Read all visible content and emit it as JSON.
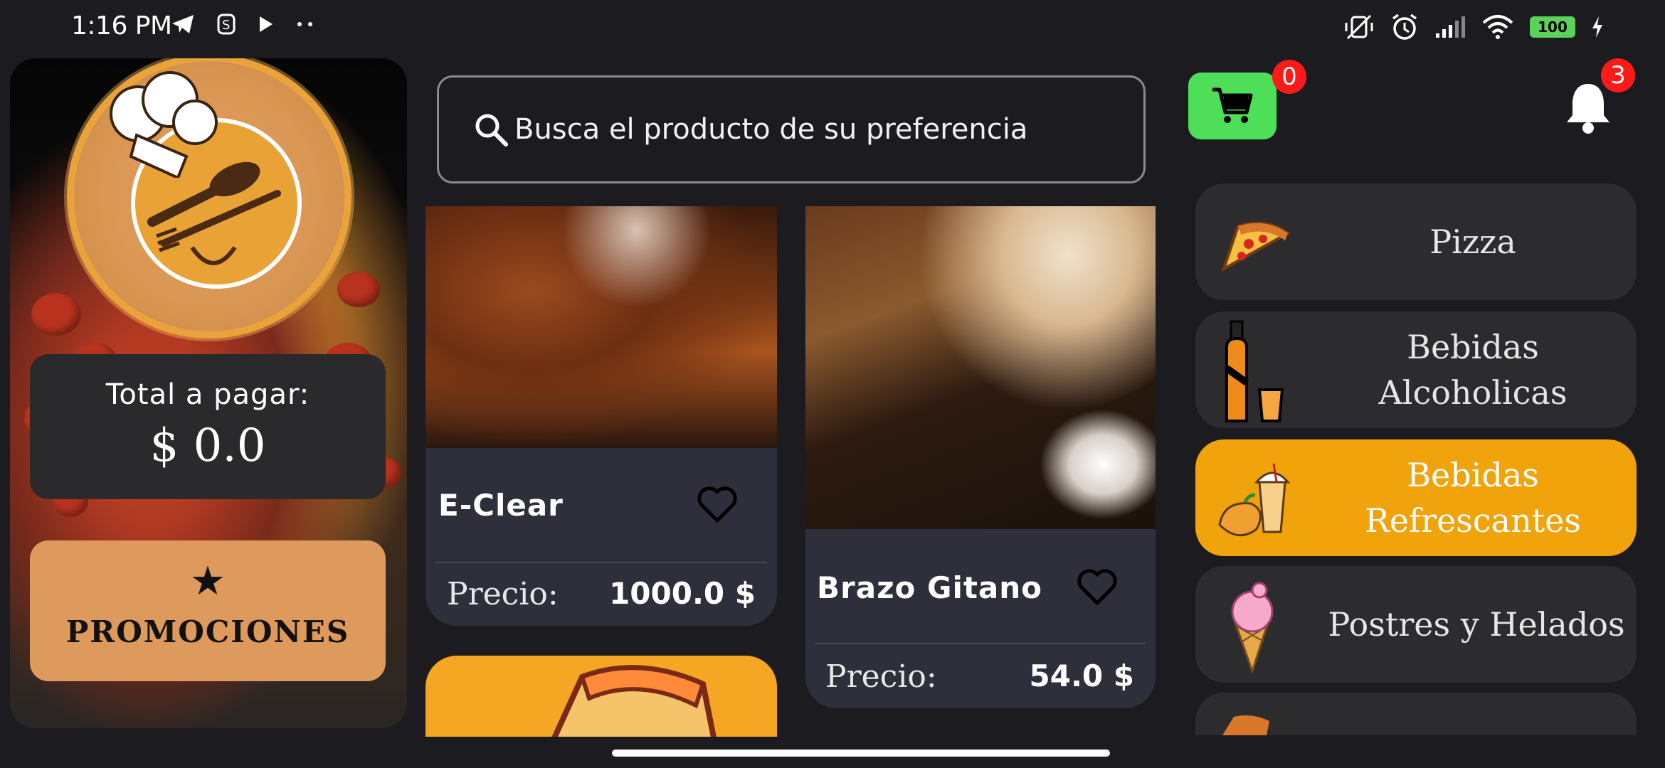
{
  "status_bar": {
    "time": "1:16 PM",
    "battery": "100"
  },
  "search": {
    "placeholder": "Busca el producto de su preferencia"
  },
  "summary": {
    "total_label": "Total a pagar:",
    "total_value": "$ 0.0"
  },
  "promotions": {
    "label": "PROMOCIONES"
  },
  "cart": {
    "count": "0"
  },
  "notifications": {
    "count": "3"
  },
  "products": [
    {
      "name": "E-Clear",
      "price_label": "Precio:",
      "price": "1000.0 $"
    },
    {
      "name": "Brazo Gitano",
      "price_label": "Precio:",
      "price": "54.0 $"
    }
  ],
  "categories": [
    {
      "label": "Pizza",
      "active": false
    },
    {
      "label": "Bebidas Alcoholicas",
      "line1": "Bebidas",
      "line2": "Alcoholicas",
      "active": false
    },
    {
      "label": "Bebidas Refrescantes",
      "line1": "Bebidas",
      "line2": "Refrescantes",
      "active": true
    },
    {
      "label": "Postres y Helados",
      "active": false
    }
  ],
  "colors": {
    "background": "#1c1c20",
    "active_category": "#f0a30a",
    "cart_green": "#4ede58",
    "promo": "#dd9a5c",
    "badge_red": "#ff1a1a"
  }
}
